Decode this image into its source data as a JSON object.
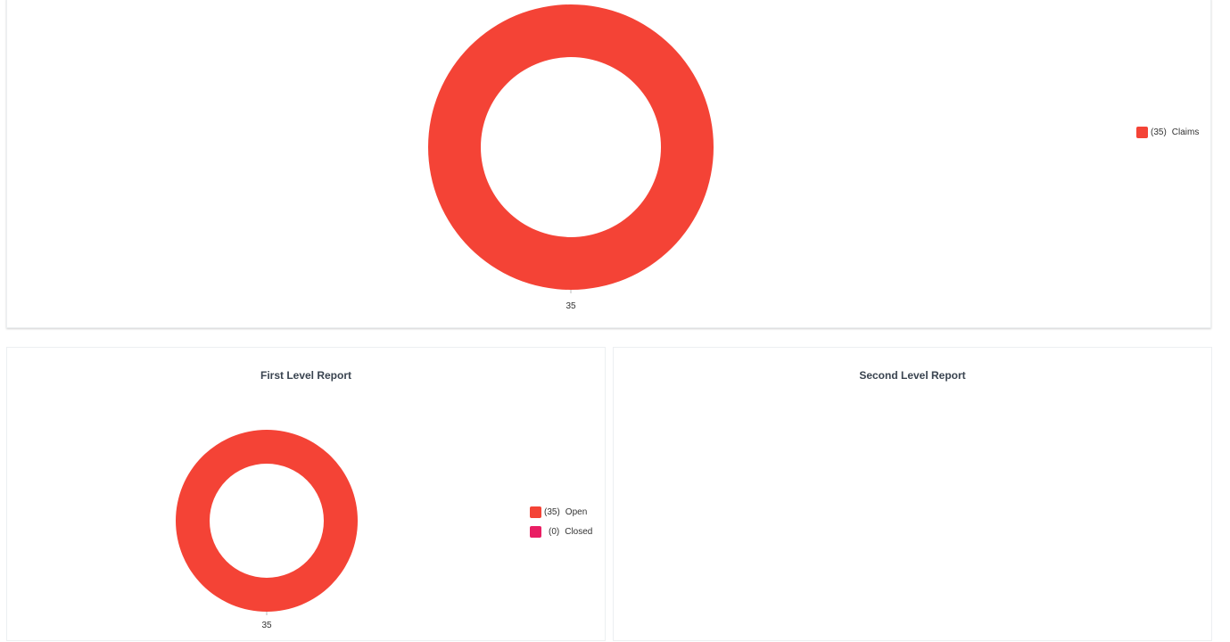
{
  "chart_data": [
    {
      "type": "pie",
      "variant": "donut",
      "title": "",
      "slices": [
        {
          "label": "Claims",
          "value": 35,
          "color": "#f44336"
        }
      ],
      "data_labels": [
        "35"
      ],
      "legend": {
        "placement": "right",
        "items": [
          {
            "count": "(35)",
            "label": "Claims",
            "color": "#f44336"
          }
        ]
      }
    },
    {
      "type": "pie",
      "variant": "donut",
      "title": "First Level Report",
      "slices": [
        {
          "label": "Open",
          "value": 35,
          "color": "#f44336"
        },
        {
          "label": "Closed",
          "value": 0,
          "color": "#e91e63"
        }
      ],
      "data_labels": [
        "35"
      ],
      "legend": {
        "placement": "right",
        "items": [
          {
            "count": "(35)",
            "label": "Open",
            "color": "#f44336"
          },
          {
            "count": "(0)",
            "label": "Closed",
            "color": "#e91e63"
          }
        ]
      }
    },
    {
      "type": "pie",
      "variant": "donut",
      "title": "Second Level Report",
      "slices": []
    }
  ]
}
